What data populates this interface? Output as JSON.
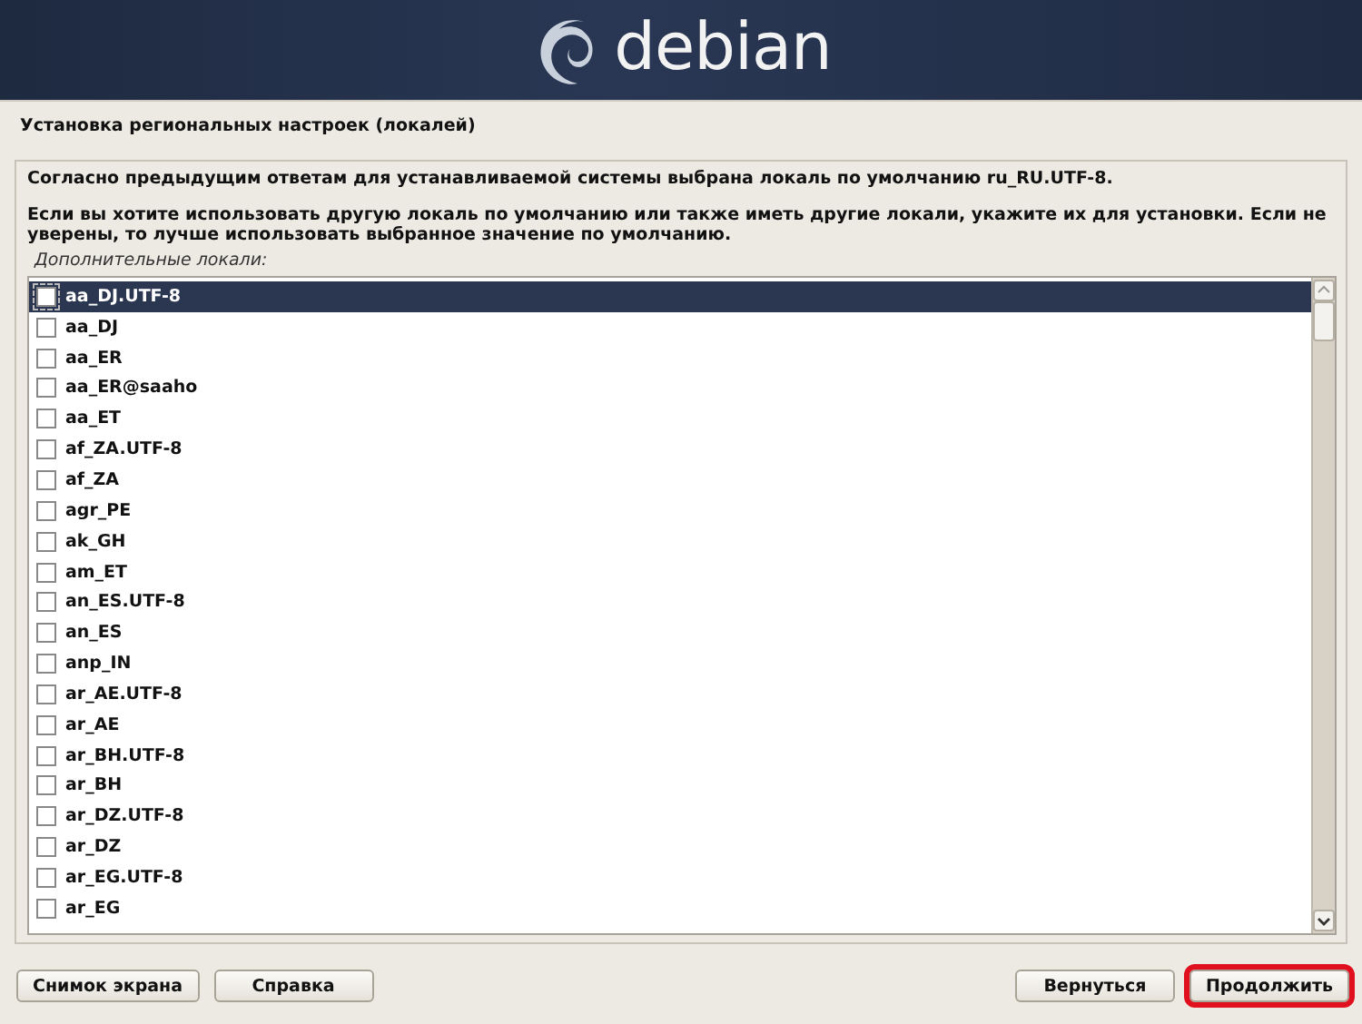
{
  "banner": {
    "logo_text": "debian"
  },
  "page_title": "Установка региональных настроек (локалей)",
  "paragraphs": [
    "Согласно предыдущим ответам для устанавливаемой системы выбрана локаль по умолчанию ru_RU.UTF-8.",
    "Если вы хотите использовать другую локаль по умолчанию или также иметь другие локали, укажите их для установки. Если не уверены, то лучше использовать выбранное значение по умолчанию."
  ],
  "list_label": "Дополнительные локали:",
  "locales": [
    {
      "label": "aa_DJ.UTF-8",
      "checked": false,
      "selected": true
    },
    {
      "label": "aa_DJ",
      "checked": false,
      "selected": false
    },
    {
      "label": "aa_ER",
      "checked": false,
      "selected": false
    },
    {
      "label": "aa_ER@saaho",
      "checked": false,
      "selected": false
    },
    {
      "label": "aa_ET",
      "checked": false,
      "selected": false
    },
    {
      "label": "af_ZA.UTF-8",
      "checked": false,
      "selected": false
    },
    {
      "label": "af_ZA",
      "checked": false,
      "selected": false
    },
    {
      "label": "agr_PE",
      "checked": false,
      "selected": false
    },
    {
      "label": "ak_GH",
      "checked": false,
      "selected": false
    },
    {
      "label": "am_ET",
      "checked": false,
      "selected": false
    },
    {
      "label": "an_ES.UTF-8",
      "checked": false,
      "selected": false
    },
    {
      "label": "an_ES",
      "checked": false,
      "selected": false
    },
    {
      "label": "anp_IN",
      "checked": false,
      "selected": false
    },
    {
      "label": "ar_AE.UTF-8",
      "checked": false,
      "selected": false
    },
    {
      "label": "ar_AE",
      "checked": false,
      "selected": false
    },
    {
      "label": "ar_BH.UTF-8",
      "checked": false,
      "selected": false
    },
    {
      "label": "ar_BH",
      "checked": false,
      "selected": false
    },
    {
      "label": "ar_DZ.UTF-8",
      "checked": false,
      "selected": false
    },
    {
      "label": "ar_DZ",
      "checked": false,
      "selected": false
    },
    {
      "label": "ar_EG.UTF-8",
      "checked": false,
      "selected": false
    },
    {
      "label": "ar_EG",
      "checked": false,
      "selected": false
    }
  ],
  "left_buttons": [
    {
      "label": "Снимок экрана",
      "highlighted": false
    },
    {
      "label": "Справка",
      "highlighted": false
    }
  ],
  "right_buttons": [
    {
      "label": "Вернуться",
      "highlighted": false
    },
    {
      "label": "Продолжить",
      "highlighted": true
    }
  ]
}
